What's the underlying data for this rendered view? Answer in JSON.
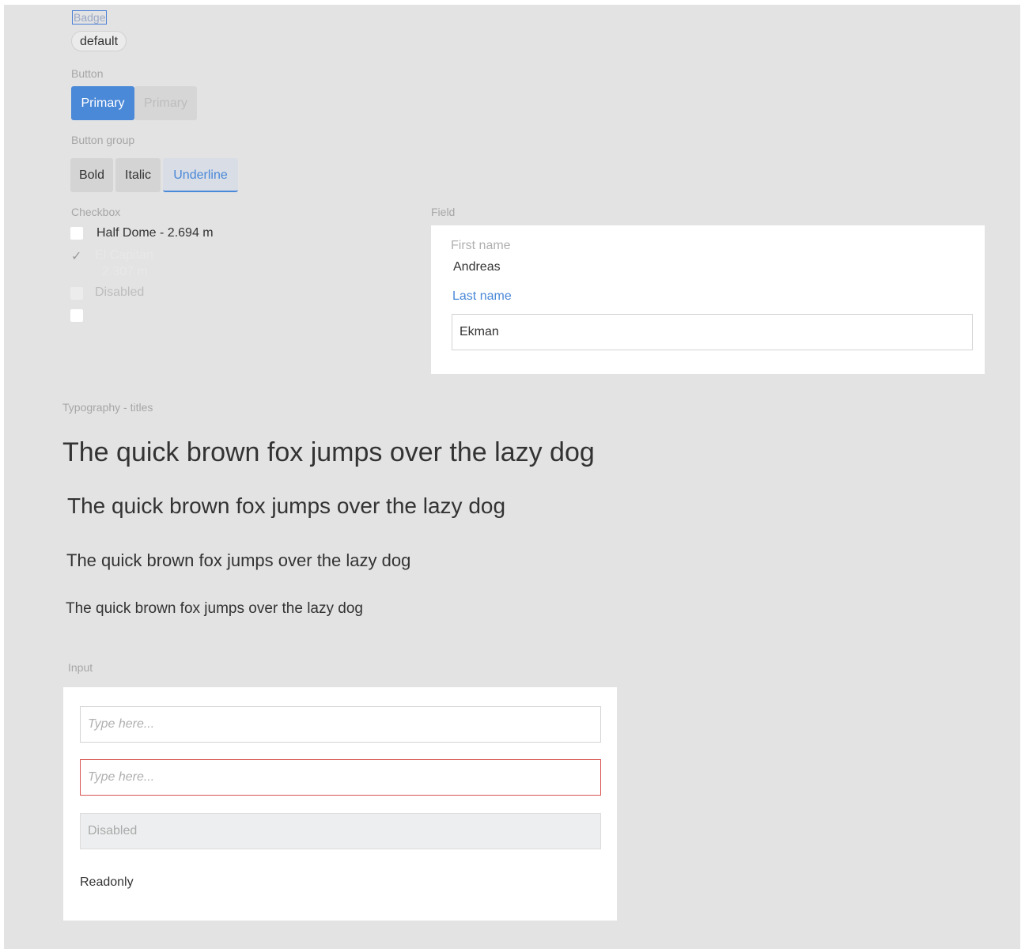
{
  "badge": {
    "section_label": "Badge",
    "text": "default"
  },
  "button": {
    "section_label": "Button",
    "primary_label": "Primary",
    "primary_disabled_label": "Primary"
  },
  "button_group": {
    "section_label": "Button group",
    "items": [
      "Bold",
      "Italic",
      "Underline"
    ],
    "active": "Underline"
  },
  "checkbox": {
    "section_label": "Checkbox",
    "items": [
      {
        "label": "Half Dome - 2.694 m",
        "checked": false,
        "state": "normal"
      },
      {
        "label": "El Capitan",
        "label_line2": "2.307 m",
        "checked": true,
        "state": "faint"
      },
      {
        "label": "Disabled",
        "checked": false,
        "state": "disabled"
      },
      {
        "label": "",
        "checked": false,
        "state": "normal"
      }
    ]
  },
  "field": {
    "section_label": "Field",
    "first_name_label": "First name",
    "first_name_value": "Andreas",
    "last_name_label": "Last name",
    "last_name_value": "Ekman"
  },
  "typography": {
    "section_label": "Typography - titles",
    "lines": [
      "The quick brown fox jumps over the lazy dog",
      "The quick brown fox jumps over the lazy dog",
      "The quick brown fox jumps over the lazy dog",
      "The quick brown fox jumps over the lazy dog"
    ]
  },
  "input": {
    "section_label": "Input",
    "placeholder": "Type here...",
    "error_placeholder": "Type here...",
    "disabled_value": "Disabled",
    "readonly_value": "Readonly"
  },
  "colors": {
    "primary": "#4a88d8",
    "error": "#d9534f",
    "background": "#e3e3e3"
  }
}
